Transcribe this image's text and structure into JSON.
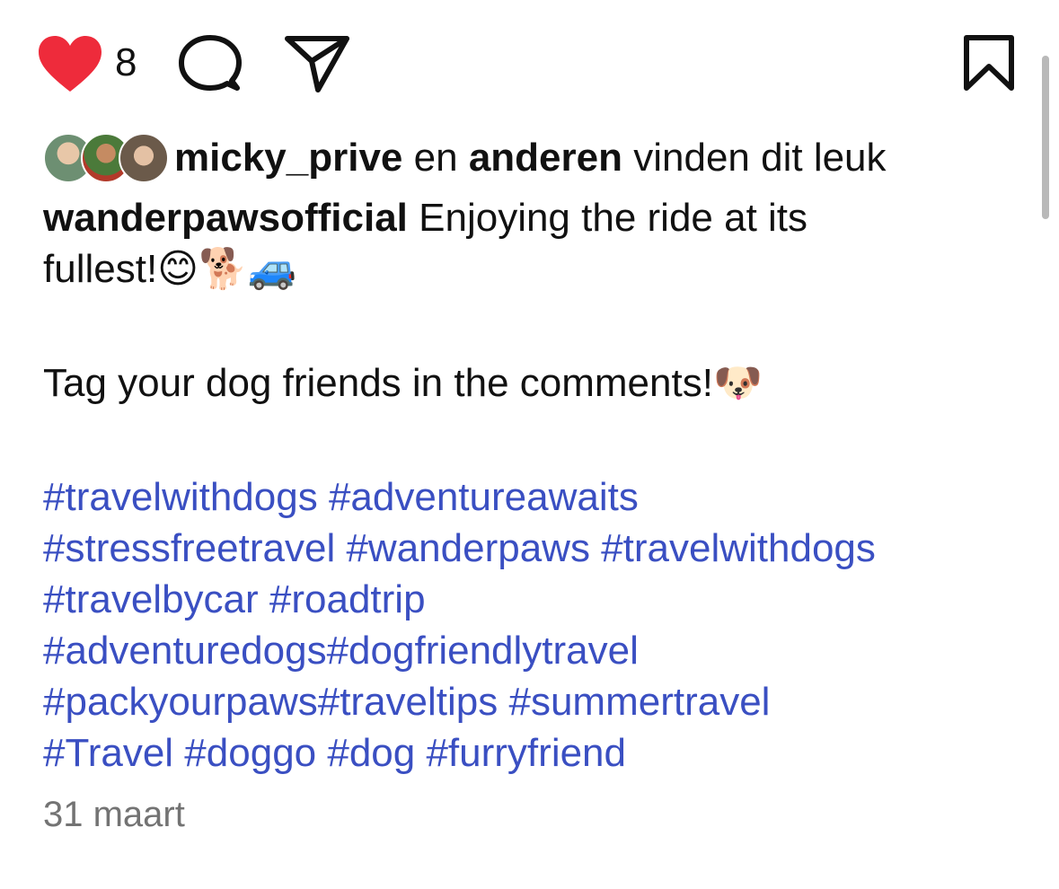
{
  "actions": {
    "like_count": "8"
  },
  "likes": {
    "user": "micky_prive",
    "conj": "en",
    "others": "anderen",
    "suffix": "vinden dit leuk"
  },
  "caption": {
    "username": "wanderpawsofficial",
    "text_line1": "Enjoying the ride at its",
    "text_line2": "fullest!😊🐕🚙",
    "text_line3": "Tag your dog friends in the comments!🐶"
  },
  "hashtag_lines": [
    "#travelwithdogs #adventureawaits",
    "#stressfreetravel #wanderpaws #travelwithdogs",
    "#travelbycar #roadtrip",
    "#adventuredogs#dogfriendlytravel",
    "#packyourpaws#traveltips #summertravel",
    "#Travel #doggo #dog #furryfriend"
  ],
  "date": "31 maart",
  "colors": {
    "heart": "#ee2b3b",
    "hashtag": "#3a4fc2",
    "date": "#737373"
  }
}
